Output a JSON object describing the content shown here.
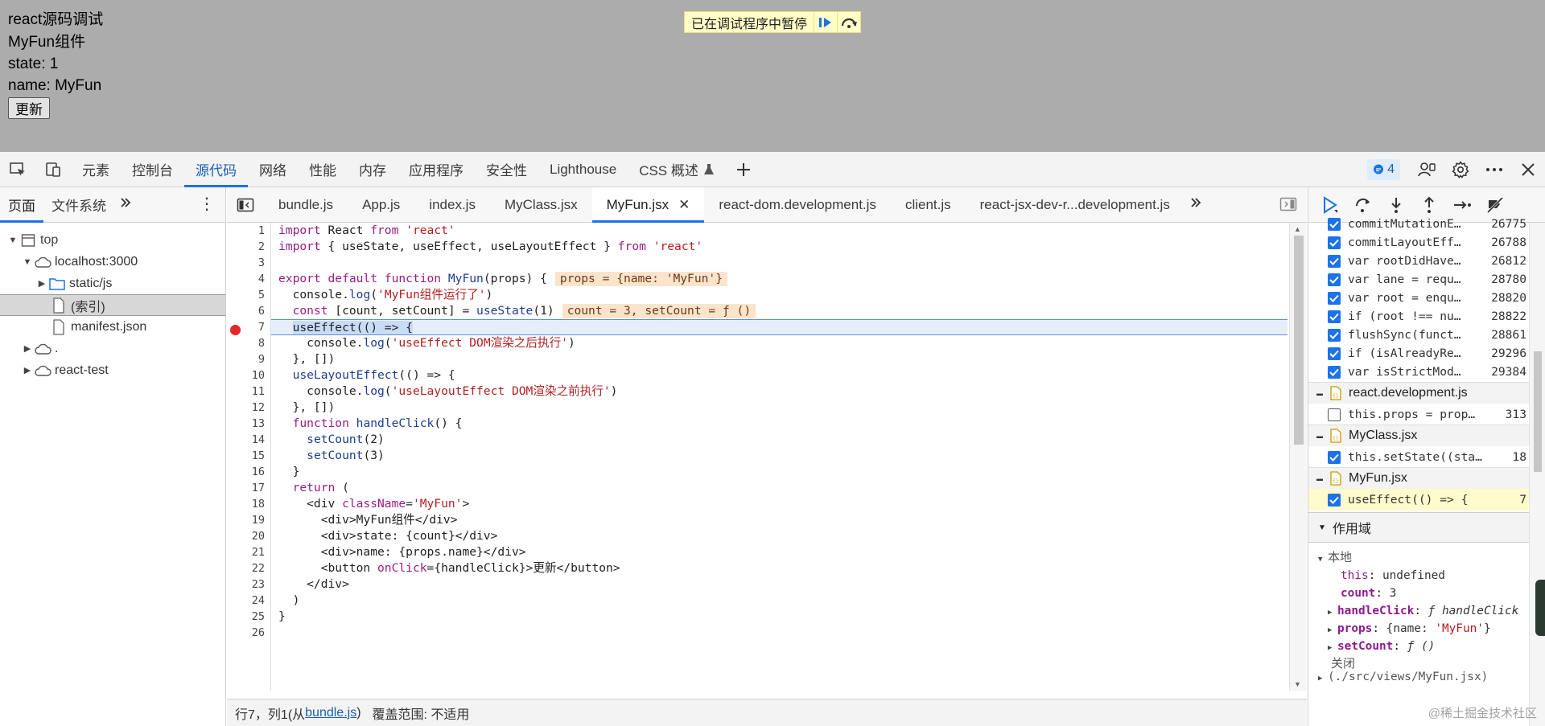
{
  "preview": {
    "lines": [
      "react源码调试",
      "MyFun组件",
      "state: 1",
      "name: MyFun"
    ],
    "button_label": "更新",
    "paused_text": "已在调试程序中暂停"
  },
  "main_tabs": [
    "元素",
    "控制台",
    "源代码",
    "网络",
    "性能",
    "内存",
    "应用程序",
    "安全性",
    "Lighthouse",
    "CSS 概述"
  ],
  "main_tabs_active": "源代码",
  "issues_count": "4",
  "navigator": {
    "tabs": [
      "页面",
      "文件系统"
    ],
    "tree": [
      "top",
      "localhost:3000",
      "static/js",
      "(索引)",
      "manifest.json",
      ".",
      "react-test"
    ]
  },
  "file_tabs": [
    "bundle.js",
    "App.js",
    "index.js",
    "MyClass.jsx",
    "MyFun.jsx",
    "react-dom.development.js",
    "client.js",
    "react-jsx-dev-r...development.js"
  ],
  "file_tabs_active": "MyFun.jsx",
  "code": {
    "inline_values": {
      "props": "props = {name: 'MyFun'}",
      "count": "count = 3, setCount = ƒ ()"
    },
    "strings": {
      "react": "'react'",
      "log_run": "'MyFun组件运行了'",
      "log_effect": "'useEffect DOM渲染之后执行'",
      "log_layout": "'useLayoutEffect DOM渲染之前执行'",
      "classname": "'MyFun'"
    },
    "text": {
      "l1": "import React from 'react'",
      "l5": "MyFun组件",
      "l22": "更新"
    }
  },
  "status": {
    "position": "行7，列1",
    "from_prefix": "(从",
    "from_file": "bundle.js",
    "from_suffix": ")",
    "coverage": "覆盖范围: 不适用"
  },
  "breakpoints": [
    {
      "text": "commitMutationE…",
      "line": "26775",
      "checked": true
    },
    {
      "text": "commitLayoutEff…",
      "line": "26788",
      "checked": true
    },
    {
      "text": "var rootDidHave…",
      "line": "26812",
      "checked": true
    },
    {
      "text": "var lane = requ…",
      "line": "28780",
      "checked": true
    },
    {
      "text": "var root = enqu…",
      "line": "28820",
      "checked": true
    },
    {
      "text": "if (root !== nu…",
      "line": "28822",
      "checked": true
    },
    {
      "text": "flushSync(funct…",
      "line": "28861",
      "checked": true
    },
    {
      "text": "if (isAlreadyRe…",
      "line": "29296",
      "checked": true
    },
    {
      "text": "var isStrictMod…",
      "line": "29384",
      "checked": true
    }
  ],
  "bp_files": [
    {
      "name": "react.development.js",
      "items": [
        {
          "text": "this.props = prop…",
          "line": "313",
          "checked": false
        }
      ]
    },
    {
      "name": "MyClass.jsx",
      "items": [
        {
          "text": "this.setState((sta…",
          "line": "18",
          "checked": true
        }
      ]
    },
    {
      "name": "MyFun.jsx",
      "items": [
        {
          "text": "useEffect(() => {",
          "line": "7",
          "checked": true
        }
      ]
    }
  ],
  "scope": {
    "header": "作用域",
    "local": "本地",
    "this_key": "this",
    "this_val": "undefined",
    "count_key": "count",
    "count_val": "3",
    "handle_key": "handleClick",
    "handle_val": "ƒ handleClick",
    "props_key": "props",
    "props_val": "{name: 'MyFun'}",
    "setcount_key": "setCount",
    "setcount_val": "ƒ ()",
    "closure": "关闭",
    "closure_path": "(./src/views/MyFun.jsx)"
  },
  "watermark": "@稀土掘金技术社区",
  "colors": {
    "accent": "#1a73e8",
    "breakpoint": "#e8262a",
    "inline_value_bg": "#fbe4cc"
  }
}
